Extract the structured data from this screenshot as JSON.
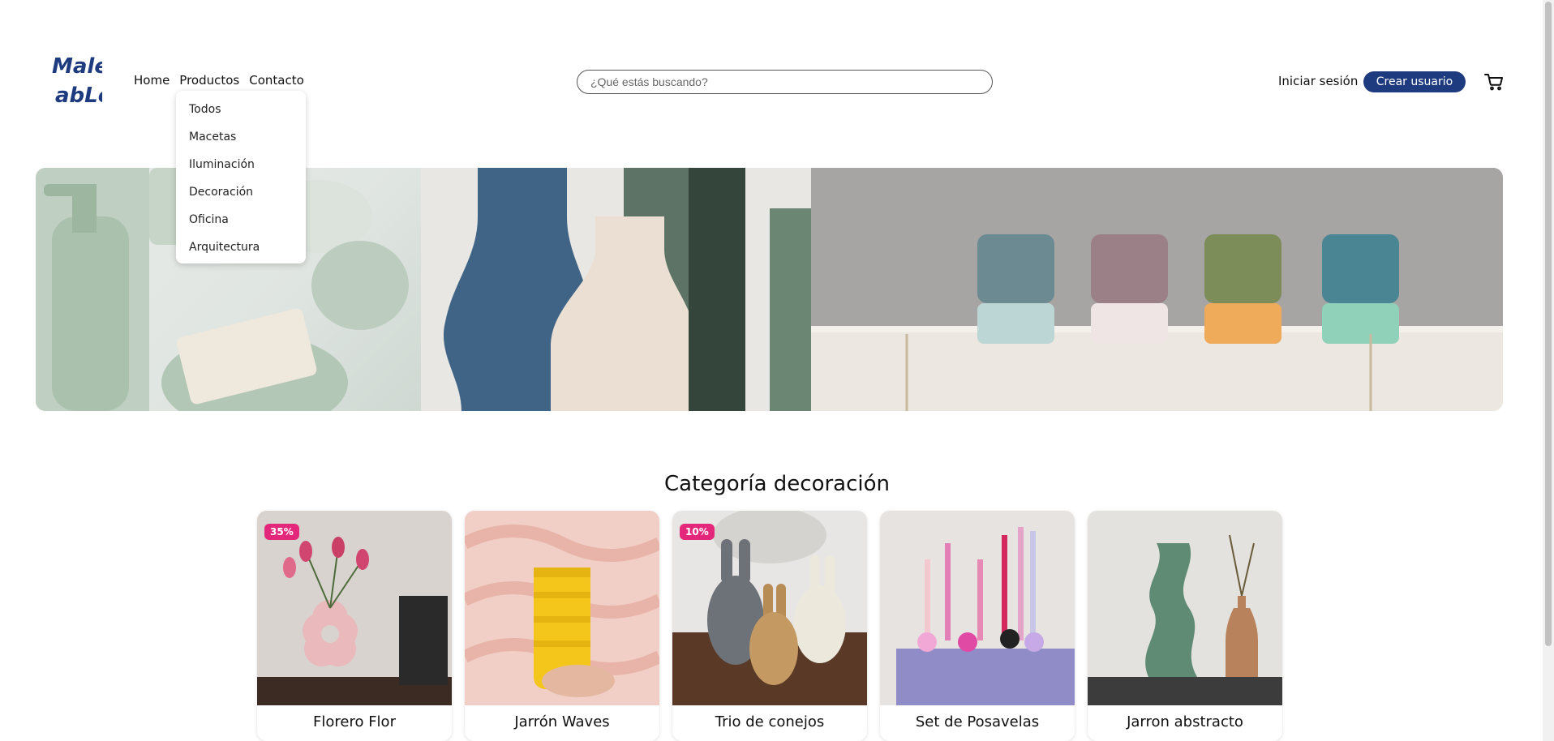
{
  "header": {
    "logo": "Maleable",
    "nav": [
      {
        "label": "Home"
      },
      {
        "label": "Productos"
      },
      {
        "label": "Contacto"
      }
    ],
    "dropdown": [
      "Todos",
      "Macetas",
      "Iluminación",
      "Decoración",
      "Oficina",
      "Arquitectura"
    ],
    "search": {
      "placeholder": "¿Qué estás buscando?"
    },
    "login_label": "Iniciar sesión",
    "create_user_label": "Crear usuario",
    "brand_color": "#1f3b80",
    "cart_icon": "cart-icon"
  },
  "section": {
    "title": "Categoría decoración",
    "products": [
      {
        "name": "Florero Flor",
        "badge": "35%"
      },
      {
        "name": "Jarrón Waves",
        "badge": ""
      },
      {
        "name": "Trio de conejos",
        "badge": "10%"
      },
      {
        "name": "Set de Posavelas",
        "badge": ""
      },
      {
        "name": "Jarron abstracto",
        "badge": ""
      }
    ],
    "badge_color": "#e3287c"
  }
}
